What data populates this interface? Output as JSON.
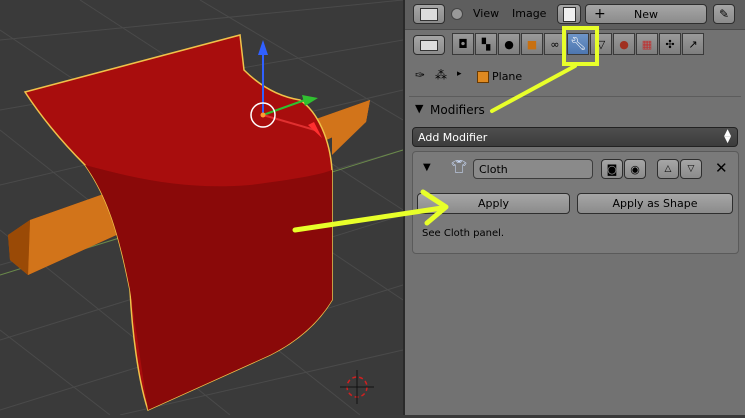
{
  "header": {
    "menu_view": "View",
    "menu_image": "Image",
    "new_label": "New"
  },
  "breadcrumb": {
    "object_name": "Plane"
  },
  "modifiers": {
    "section_title": "Modifiers",
    "add_modifier_label": "Add Modifier",
    "modifier_name": "Cloth",
    "apply_label": "Apply",
    "apply_as_shape_label": "Apply as Shape",
    "info_text": "See Cloth panel."
  },
  "colors": {
    "cloth_red": "#a80d0d",
    "rod_orange": "#c86a10",
    "annotation_yellow": "#e8ff2a",
    "active_tab": "#5b84bf"
  },
  "icons": [
    "editor-type-icon",
    "view-menu-icon",
    "image-editor-icon",
    "plus-icon",
    "pin-icon",
    "camera-icon",
    "render-icon",
    "render-layers-icon",
    "scene-icon",
    "world-icon",
    "object-icon",
    "constraints-icon",
    "wrench-modifier-icon",
    "data-icon",
    "material-icon",
    "texture-icon",
    "particles-icon",
    "physics-icon",
    "cloth-shirt-icon",
    "eye-icon",
    "arrow-up-icon",
    "arrow-down-icon",
    "close-icon",
    "cube-icon"
  ]
}
